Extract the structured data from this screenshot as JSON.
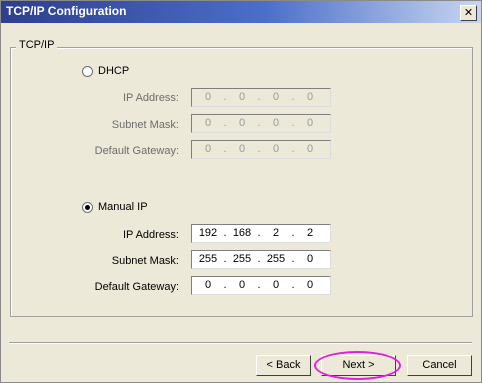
{
  "window": {
    "title": "TCP/IP Configuration",
    "close_label": "✕"
  },
  "group": {
    "label": "TCP/IP"
  },
  "dhcp": {
    "label": "DHCP",
    "selected": false,
    "fields": [
      {
        "label": "IP Address:",
        "octets": [
          "0",
          "0",
          "0",
          "0"
        ]
      },
      {
        "label": "Subnet Mask:",
        "octets": [
          "0",
          "0",
          "0",
          "0"
        ]
      },
      {
        "label": "Default Gateway:",
        "octets": [
          "0",
          "0",
          "0",
          "0"
        ]
      }
    ]
  },
  "manual": {
    "label": "Manual IP",
    "selected": true,
    "fields": [
      {
        "label": "IP Address:",
        "octets": [
          "192",
          "168",
          "2",
          "2"
        ]
      },
      {
        "label": "Subnet Mask:",
        "octets": [
          "255",
          "255",
          "255",
          "0"
        ]
      },
      {
        "label": "Default Gateway:",
        "octets": [
          "0",
          "0",
          "0",
          "0"
        ]
      }
    ]
  },
  "buttons": {
    "back": "< Back",
    "next": "Next >",
    "cancel": "Cancel"
  },
  "colors": {
    "highlight": "#e020e0",
    "title_bar": "#2e3e8f"
  }
}
